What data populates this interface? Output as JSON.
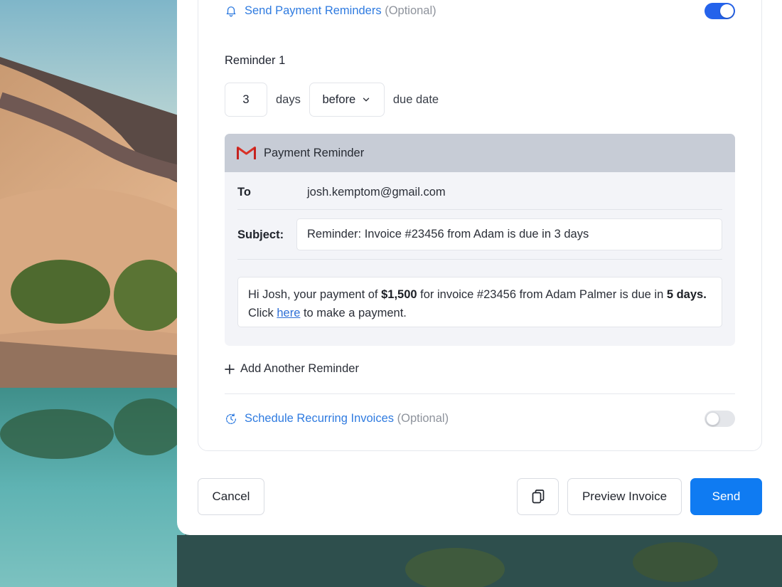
{
  "reminders_section": {
    "title": "Send Payment Reminders",
    "optional_tag": "(Optional)",
    "enabled": true
  },
  "reminder": {
    "label": "Reminder 1",
    "days_value": "3",
    "days_word": "days",
    "relation_selected": "before",
    "suffix": "due date"
  },
  "email": {
    "header_title": "Payment Reminder",
    "to_label": "To",
    "to_value": "josh.kemptom@gmail.com",
    "subject_label": "Subject:",
    "subject_value": "Reminder: Invoice #23456 from Adam is due in 3 days",
    "body": {
      "part1": "Hi Josh, your payment of ",
      "amount": "$1,500",
      "part2": " for invoice #23456 from Adam Palmer is due in ",
      "days": "5 days.",
      "part3": " Click ",
      "link_text": "here",
      "part4": " to make a payment."
    }
  },
  "add_reminder_label": "Add Another Reminder",
  "recurring_section": {
    "title": "Schedule Recurring Invoices",
    "optional_tag": "(Optional)",
    "enabled": false
  },
  "footer": {
    "cancel_label": "Cancel",
    "preview_label": "Preview Invoice",
    "send_label": "Send"
  },
  "colors": {
    "accent": "#2563eb",
    "send_button": "#0f7bf2",
    "link": "#2f7be0"
  }
}
